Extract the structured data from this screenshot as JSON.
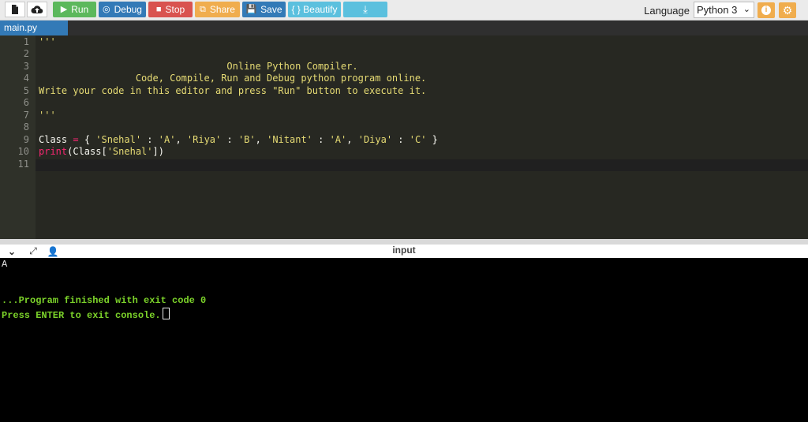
{
  "toolbar": {
    "run_label": "Run",
    "debug_label": "Debug",
    "stop_label": "Stop",
    "share_label": "Share",
    "save_label": "Save",
    "beautify_label": "{ } Beautify",
    "language_label": "Language",
    "language_value": "Python 3",
    "colors": {
      "run": "#5cb85c",
      "debug": "#337ab7",
      "stop": "#d9534f",
      "share": "#f0ad4e",
      "save": "#337ab7",
      "beautify": "#5bc0de",
      "download": "#5bc0de"
    },
    "icons": [
      "new-file-icon",
      "cloud-upload-icon",
      "play-icon",
      "debug-icon",
      "stop-icon",
      "share-icon",
      "save-icon",
      "download-icon",
      "info-icon",
      "gear-icon"
    ]
  },
  "tabs": [
    {
      "label": "main.py"
    }
  ],
  "editor": {
    "line_numbers": [
      "1",
      "2",
      "3",
      "4",
      "5",
      "6",
      "7",
      "8",
      "9",
      "10",
      "11"
    ],
    "lines": {
      "l1": "'''",
      "l3": "                                 Online Python Compiler.",
      "l4": "                 Code, Compile, Run and Debug python program online.",
      "l5": "Write your code in this editor and press \"Run\" button to execute it.",
      "l7": "'''",
      "l9_name": "Class ",
      "l9_eq": "=",
      "l9_open": " { ",
      "l9_k1": "'Snehal'",
      "l9_c1": " : ",
      "l9_v1": "'A'",
      "l9_sep1": ", ",
      "l9_k2": "'Riya'",
      "l9_c2": " : ",
      "l9_v2": "'B'",
      "l9_sep2": ", ",
      "l9_k3": "'Nitant'",
      "l9_c3": " : ",
      "l9_v3": "'A'",
      "l9_sep3": ", ",
      "l9_k4": "'Diya'",
      "l9_c4": " : ",
      "l9_v4": "'C'",
      "l9_close": " }",
      "l10_fn": "print",
      "l10_a": "(Class[",
      "l10_s": "'Snehal'",
      "l10_b": "])"
    }
  },
  "io": {
    "title": "input",
    "icons": [
      "chevron-down-icon",
      "expand-icon",
      "debug-user-icon"
    ]
  },
  "console": {
    "output": "A",
    "finished": "...Program finished with exit code 0",
    "press": "Press ENTER to exit console."
  }
}
